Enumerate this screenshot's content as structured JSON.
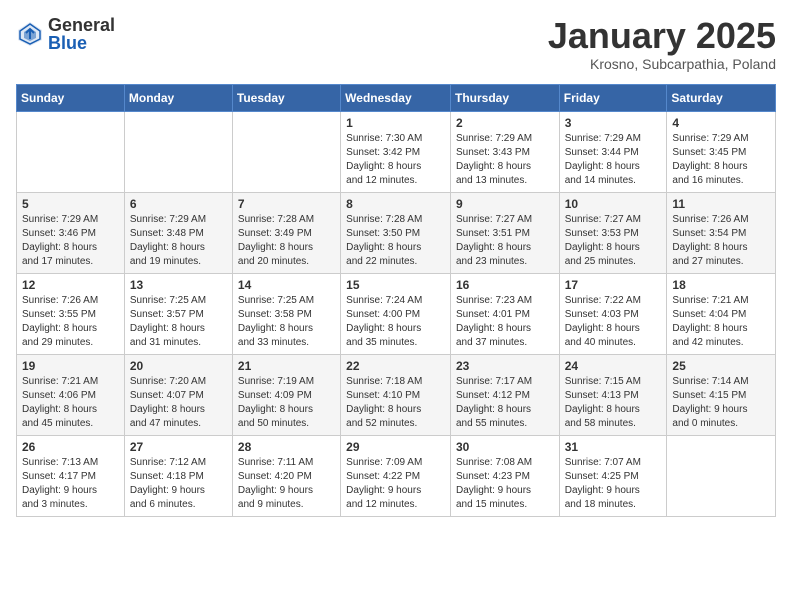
{
  "header": {
    "logo_general": "General",
    "logo_blue": "Blue",
    "month": "January 2025",
    "location": "Krosno, Subcarpathia, Poland"
  },
  "days_of_week": [
    "Sunday",
    "Monday",
    "Tuesday",
    "Wednesday",
    "Thursday",
    "Friday",
    "Saturday"
  ],
  "weeks": [
    [
      {
        "day": "",
        "info": ""
      },
      {
        "day": "",
        "info": ""
      },
      {
        "day": "",
        "info": ""
      },
      {
        "day": "1",
        "info": "Sunrise: 7:30 AM\nSunset: 3:42 PM\nDaylight: 8 hours\nand 12 minutes."
      },
      {
        "day": "2",
        "info": "Sunrise: 7:29 AM\nSunset: 3:43 PM\nDaylight: 8 hours\nand 13 minutes."
      },
      {
        "day": "3",
        "info": "Sunrise: 7:29 AM\nSunset: 3:44 PM\nDaylight: 8 hours\nand 14 minutes."
      },
      {
        "day": "4",
        "info": "Sunrise: 7:29 AM\nSunset: 3:45 PM\nDaylight: 8 hours\nand 16 minutes."
      }
    ],
    [
      {
        "day": "5",
        "info": "Sunrise: 7:29 AM\nSunset: 3:46 PM\nDaylight: 8 hours\nand 17 minutes."
      },
      {
        "day": "6",
        "info": "Sunrise: 7:29 AM\nSunset: 3:48 PM\nDaylight: 8 hours\nand 19 minutes."
      },
      {
        "day": "7",
        "info": "Sunrise: 7:28 AM\nSunset: 3:49 PM\nDaylight: 8 hours\nand 20 minutes."
      },
      {
        "day": "8",
        "info": "Sunrise: 7:28 AM\nSunset: 3:50 PM\nDaylight: 8 hours\nand 22 minutes."
      },
      {
        "day": "9",
        "info": "Sunrise: 7:27 AM\nSunset: 3:51 PM\nDaylight: 8 hours\nand 23 minutes."
      },
      {
        "day": "10",
        "info": "Sunrise: 7:27 AM\nSunset: 3:53 PM\nDaylight: 8 hours\nand 25 minutes."
      },
      {
        "day": "11",
        "info": "Sunrise: 7:26 AM\nSunset: 3:54 PM\nDaylight: 8 hours\nand 27 minutes."
      }
    ],
    [
      {
        "day": "12",
        "info": "Sunrise: 7:26 AM\nSunset: 3:55 PM\nDaylight: 8 hours\nand 29 minutes."
      },
      {
        "day": "13",
        "info": "Sunrise: 7:25 AM\nSunset: 3:57 PM\nDaylight: 8 hours\nand 31 minutes."
      },
      {
        "day": "14",
        "info": "Sunrise: 7:25 AM\nSunset: 3:58 PM\nDaylight: 8 hours\nand 33 minutes."
      },
      {
        "day": "15",
        "info": "Sunrise: 7:24 AM\nSunset: 4:00 PM\nDaylight: 8 hours\nand 35 minutes."
      },
      {
        "day": "16",
        "info": "Sunrise: 7:23 AM\nSunset: 4:01 PM\nDaylight: 8 hours\nand 37 minutes."
      },
      {
        "day": "17",
        "info": "Sunrise: 7:22 AM\nSunset: 4:03 PM\nDaylight: 8 hours\nand 40 minutes."
      },
      {
        "day": "18",
        "info": "Sunrise: 7:21 AM\nSunset: 4:04 PM\nDaylight: 8 hours\nand 42 minutes."
      }
    ],
    [
      {
        "day": "19",
        "info": "Sunrise: 7:21 AM\nSunset: 4:06 PM\nDaylight: 8 hours\nand 45 minutes."
      },
      {
        "day": "20",
        "info": "Sunrise: 7:20 AM\nSunset: 4:07 PM\nDaylight: 8 hours\nand 47 minutes."
      },
      {
        "day": "21",
        "info": "Sunrise: 7:19 AM\nSunset: 4:09 PM\nDaylight: 8 hours\nand 50 minutes."
      },
      {
        "day": "22",
        "info": "Sunrise: 7:18 AM\nSunset: 4:10 PM\nDaylight: 8 hours\nand 52 minutes."
      },
      {
        "day": "23",
        "info": "Sunrise: 7:17 AM\nSunset: 4:12 PM\nDaylight: 8 hours\nand 55 minutes."
      },
      {
        "day": "24",
        "info": "Sunrise: 7:15 AM\nSunset: 4:13 PM\nDaylight: 8 hours\nand 58 minutes."
      },
      {
        "day": "25",
        "info": "Sunrise: 7:14 AM\nSunset: 4:15 PM\nDaylight: 9 hours\nand 0 minutes."
      }
    ],
    [
      {
        "day": "26",
        "info": "Sunrise: 7:13 AM\nSunset: 4:17 PM\nDaylight: 9 hours\nand 3 minutes."
      },
      {
        "day": "27",
        "info": "Sunrise: 7:12 AM\nSunset: 4:18 PM\nDaylight: 9 hours\nand 6 minutes."
      },
      {
        "day": "28",
        "info": "Sunrise: 7:11 AM\nSunset: 4:20 PM\nDaylight: 9 hours\nand 9 minutes."
      },
      {
        "day": "29",
        "info": "Sunrise: 7:09 AM\nSunset: 4:22 PM\nDaylight: 9 hours\nand 12 minutes."
      },
      {
        "day": "30",
        "info": "Sunrise: 7:08 AM\nSunset: 4:23 PM\nDaylight: 9 hours\nand 15 minutes."
      },
      {
        "day": "31",
        "info": "Sunrise: 7:07 AM\nSunset: 4:25 PM\nDaylight: 9 hours\nand 18 minutes."
      },
      {
        "day": "",
        "info": ""
      }
    ]
  ]
}
